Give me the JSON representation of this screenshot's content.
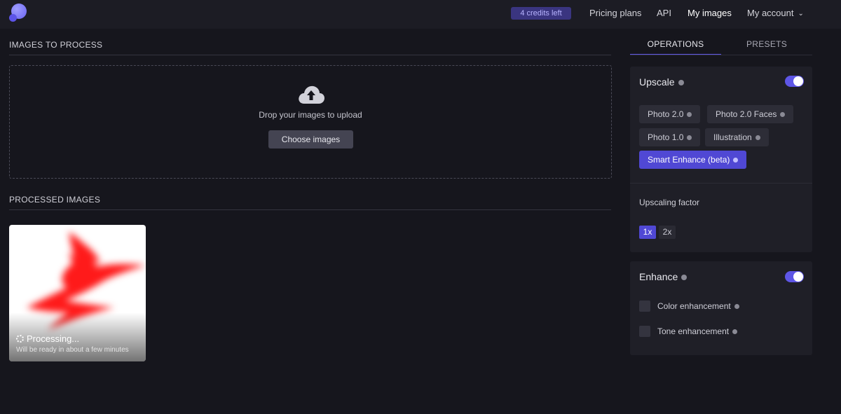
{
  "header": {
    "credits": "4 credits left",
    "nav": {
      "pricing": "Pricing plans",
      "api": "API",
      "my_images": "My images",
      "my_account": "My account"
    }
  },
  "upload": {
    "title": "IMAGES TO PROCESS",
    "drop_text": "Drop your images to upload",
    "choose_button": "Choose images"
  },
  "processed": {
    "title": "PROCESSED IMAGES",
    "items": [
      {
        "status": "Processing...",
        "eta": "Will be ready in about a few minutes"
      }
    ]
  },
  "tabs": {
    "operations": "OPERATIONS",
    "presets": "PRESETS",
    "active": "operations"
  },
  "upscale": {
    "title": "Upscale",
    "enabled": true,
    "models": [
      {
        "label": "Photo 2.0",
        "selected": false
      },
      {
        "label": "Photo 2.0 Faces",
        "selected": false
      },
      {
        "label": "Photo 1.0",
        "selected": false
      },
      {
        "label": "Illustration",
        "selected": false
      },
      {
        "label": "Smart Enhance (beta)",
        "selected": true
      }
    ],
    "factor_label": "Upscaling factor",
    "factors": [
      {
        "label": "1x",
        "selected": true
      },
      {
        "label": "2x",
        "selected": false
      }
    ]
  },
  "enhance": {
    "title": "Enhance",
    "enabled": true,
    "options": [
      {
        "label": "Color enhancement",
        "checked": false
      },
      {
        "label": "Tone enhancement",
        "checked": false
      }
    ]
  },
  "colors": {
    "accent": "#5048d4",
    "toggle": "#5e56e6",
    "background": "#16161d",
    "panel": "#1f1f27"
  }
}
